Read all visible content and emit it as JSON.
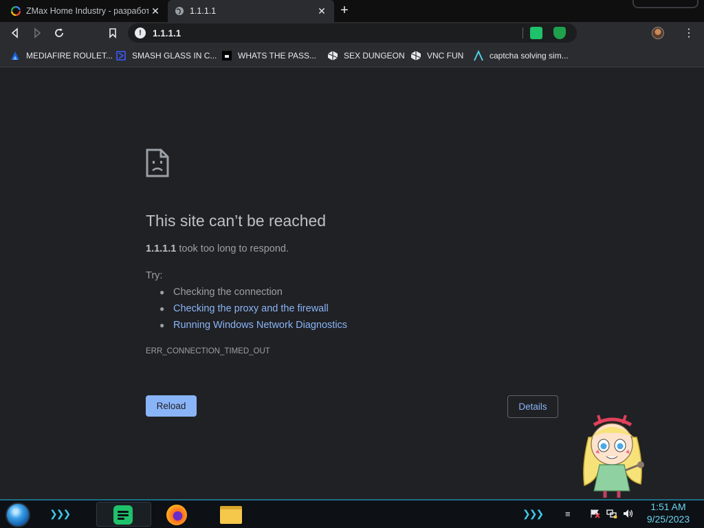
{
  "tabs": [
    {
      "title": "ZMax Home Industry - разработк",
      "close": "✕",
      "active": false
    },
    {
      "title": "1.1.1.1",
      "close": "✕",
      "active": true
    }
  ],
  "new_tab": "+",
  "toolbar": {
    "back": "‹",
    "forward": "›",
    "reload": "⟳",
    "bookmark": "bookmark-icon",
    "url": "1.1.1.1",
    "info": "!",
    "menu": "⋮"
  },
  "bookmarks": [
    {
      "label": "MEDIAFIRE ROULET...",
      "icon": "mediafire-icon"
    },
    {
      "label": "SMASH GLASS IN C...",
      "icon": "chevron-icon"
    },
    {
      "label": "WHATS THE PASS...",
      "icon": "dark-square-icon"
    },
    {
      "label": "SEX DUNGEON",
      "icon": "cube-icon"
    },
    {
      "label": "VNC FUN",
      "icon": "cube-icon"
    },
    {
      "label": "captcha solving sim...",
      "icon": "lambda-icon"
    }
  ],
  "error": {
    "title": "This site can’t be reached",
    "host": "1.1.1.1",
    "host_suffix": " took too long to respond.",
    "try_label": "Try:",
    "suggestions": [
      "Checking the connection",
      "Checking the proxy and the firewall",
      "Running Windows Network Diagnostics"
    ],
    "code": "ERR_CONNECTION_TIMED_OUT",
    "reload_label": "Reload",
    "details_label": "Details"
  },
  "taskbar": {
    "time": "1:51 AM",
    "date": "9/25/2023",
    "chevrons": "❯❯❯"
  },
  "colors": {
    "accent": "#8ab4f8",
    "background": "#202124",
    "clock": "#6cd6f2"
  }
}
